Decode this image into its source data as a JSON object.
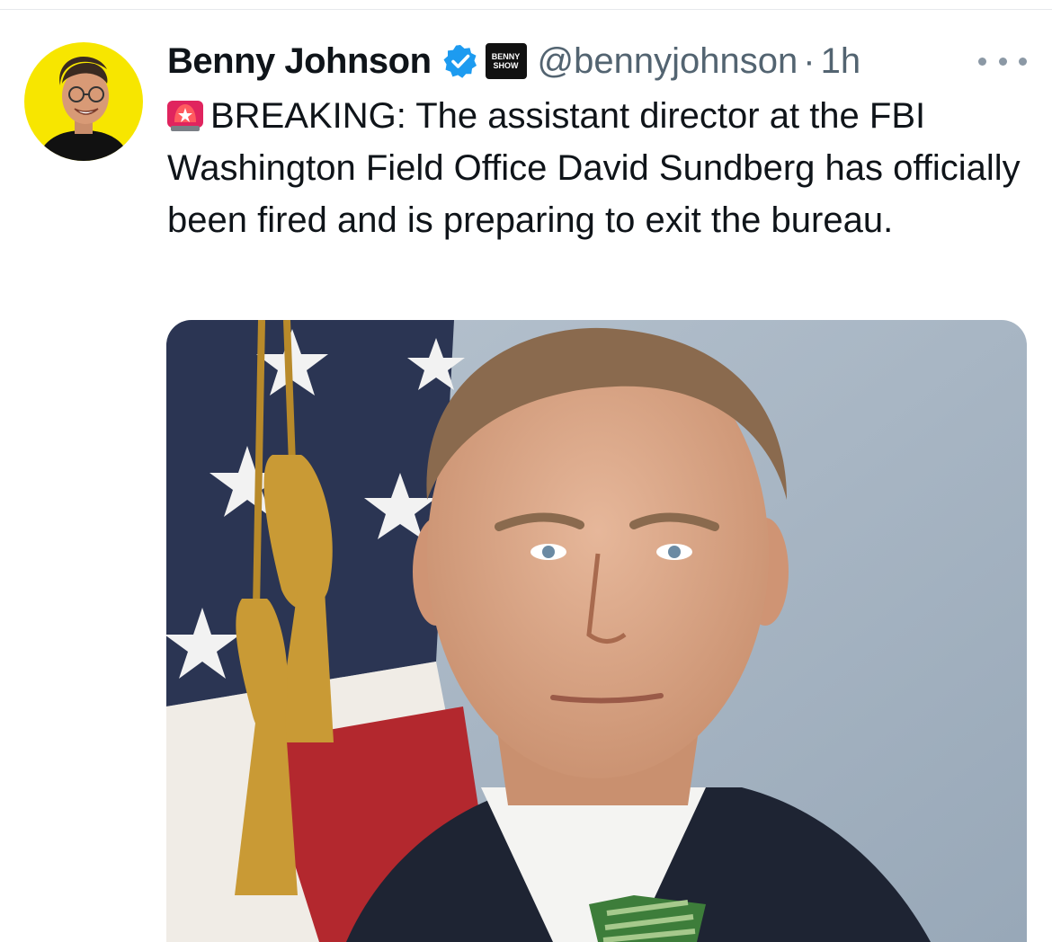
{
  "tweet": {
    "author": {
      "display_name": "Benny Johnson",
      "handle": "@bennyjohnson",
      "verified_color": "#1d9bf0",
      "affiliate_badge_text": [
        "BENNY",
        "SHOW"
      ]
    },
    "separator": "·",
    "timestamp": "1h",
    "text_icon": "rotating-light-icon",
    "text": "BREAKING: The assistant director at the FBI Washington Field Office David Sundberg has officially been fired and is preparing to exit the bureau.",
    "more_icon": "more-options-icon",
    "media": {
      "kind": "photo"
    }
  },
  "colors": {
    "avatar_background": "#f7e600",
    "secondary_text": "#536471",
    "photo_background": "#a7b4c3"
  }
}
